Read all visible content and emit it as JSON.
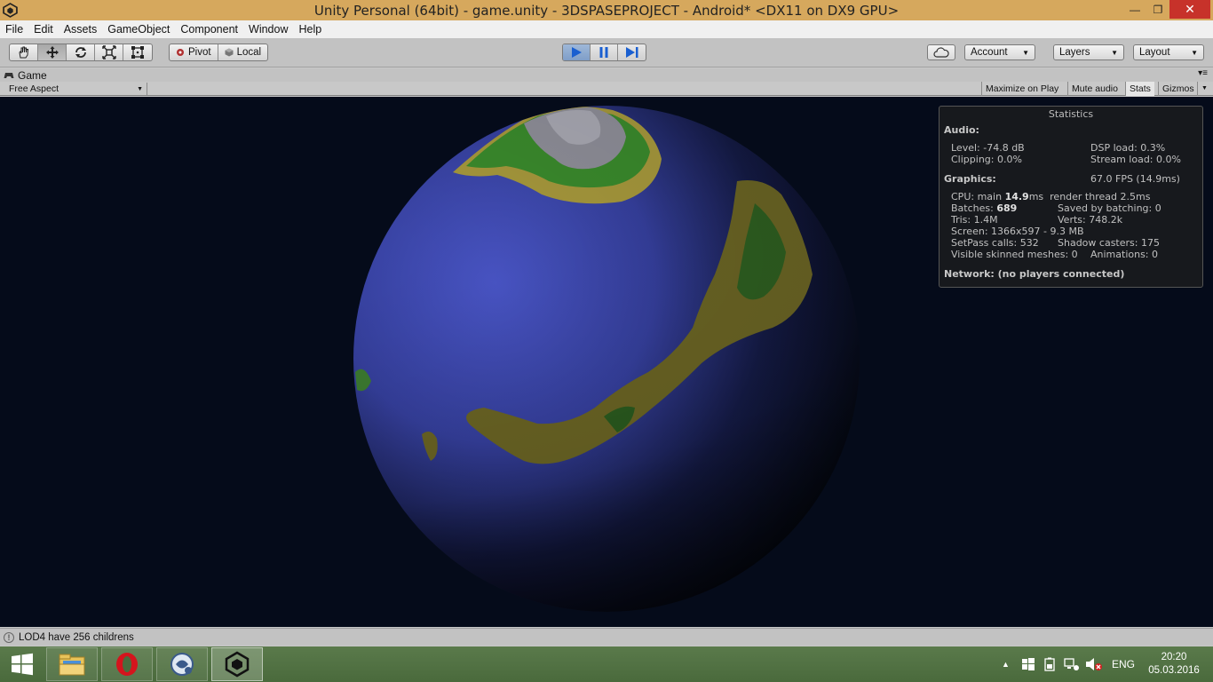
{
  "window": {
    "title": "Unity Personal (64bit) - game.unity - 3DSPASEPROJECT - Android* <DX11 on DX9 GPU>",
    "minimize_label": "—",
    "maximize_label": "❐",
    "close_label": "✕"
  },
  "menu": {
    "items": [
      "File",
      "Edit",
      "Assets",
      "GameObject",
      "Component",
      "Window",
      "Help"
    ]
  },
  "toolbar": {
    "pivot_label": "Pivot",
    "local_label": "Local",
    "account_label": "Account",
    "layers_label": "Layers",
    "layout_label": "Layout"
  },
  "game_panel": {
    "tab_label": "Game",
    "aspect_label": "Free Aspect",
    "maximize_on_play": "Maximize on Play",
    "mute_audio": "Mute audio",
    "stats": "Stats",
    "gizmos": "Gizmos"
  },
  "stats": {
    "title": "Statistics",
    "audio_header": "Audio:",
    "level": "Level: -74.8 dB",
    "dsp_load": "DSP load: 0.3%",
    "clipping": "Clipping: 0.0%",
    "stream_load": "Stream load: 0.0%",
    "graphics_header": "Graphics:",
    "fps": "67.0 FPS (14.9ms)",
    "cpu_prefix": "CPU: main ",
    "cpu_main": "14.9",
    "cpu_suffix": "ms  render thread 2.5ms",
    "batches_prefix": "Batches: ",
    "batches": "689",
    "saved_by_batching": "Saved by batching: 0",
    "tris": "Tris: 1.4M",
    "verts": "Verts: 748.2k",
    "screen": "Screen: 1366x597 - 9.3 MB",
    "setpass": "SetPass calls: 532",
    "shadow_casters": "Shadow casters: 175",
    "skinned_meshes": "Visible skinned meshes: 0",
    "animations": "Animations: 0",
    "network": "Network: (no players connected)"
  },
  "status": {
    "message": "LOD4 have 256 childrens"
  },
  "taskbar": {
    "lang": "ENG",
    "time": "20:20",
    "date": "05.03.2016",
    "apps": [
      "windows-start-icon",
      "file-explorer-icon",
      "opera-icon",
      "app-icon",
      "unity-icon"
    ]
  },
  "colors": {
    "titlebar": "#d6a85d",
    "space": "#050b1a",
    "ocean": "#3f4ab0",
    "land_green": "#3c8a2e",
    "land_sand": "#a89a3c",
    "play_active": "#7f9ec8",
    "taskbar": "#4b6b3e"
  }
}
